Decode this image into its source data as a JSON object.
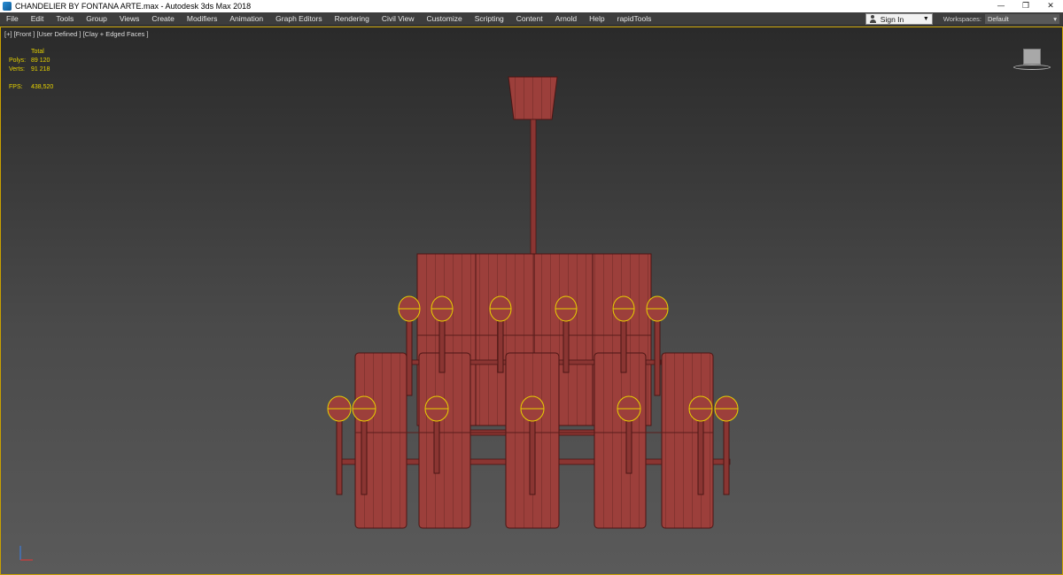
{
  "window": {
    "title": "CHANDELIER BY FONTANA ARTE.max - Autodesk 3ds Max 2018",
    "minimize_icon": "minimize-icon",
    "restore_icon": "restore-icon",
    "close_icon": "close-icon"
  },
  "menu": {
    "items": [
      "File",
      "Edit",
      "Tools",
      "Group",
      "Views",
      "Create",
      "Modifiers",
      "Animation",
      "Graph Editors",
      "Rendering",
      "Civil View",
      "Customize",
      "Scripting",
      "Content",
      "Arnold",
      "Help",
      "rapidTools"
    ],
    "signin_label": "Sign In",
    "workspaces_label": "Workspaces:",
    "workspace_value": "Default"
  },
  "viewport": {
    "label": "[+] [Front ] [User Defined ] [Clay + Edged Faces ]",
    "stats": {
      "total_label": "Total",
      "polys_label": "Polys:",
      "polys_value": "89 120",
      "verts_label": "Verts:",
      "verts_value": "91 218",
      "fps_label": "FPS:",
      "fps_value": "438,520"
    }
  },
  "colors": {
    "model_fill": "#9c3f3b",
    "model_edge": "#4a1614",
    "bulb_outline": "#e8d000",
    "viewport_border": "#c8a000"
  }
}
